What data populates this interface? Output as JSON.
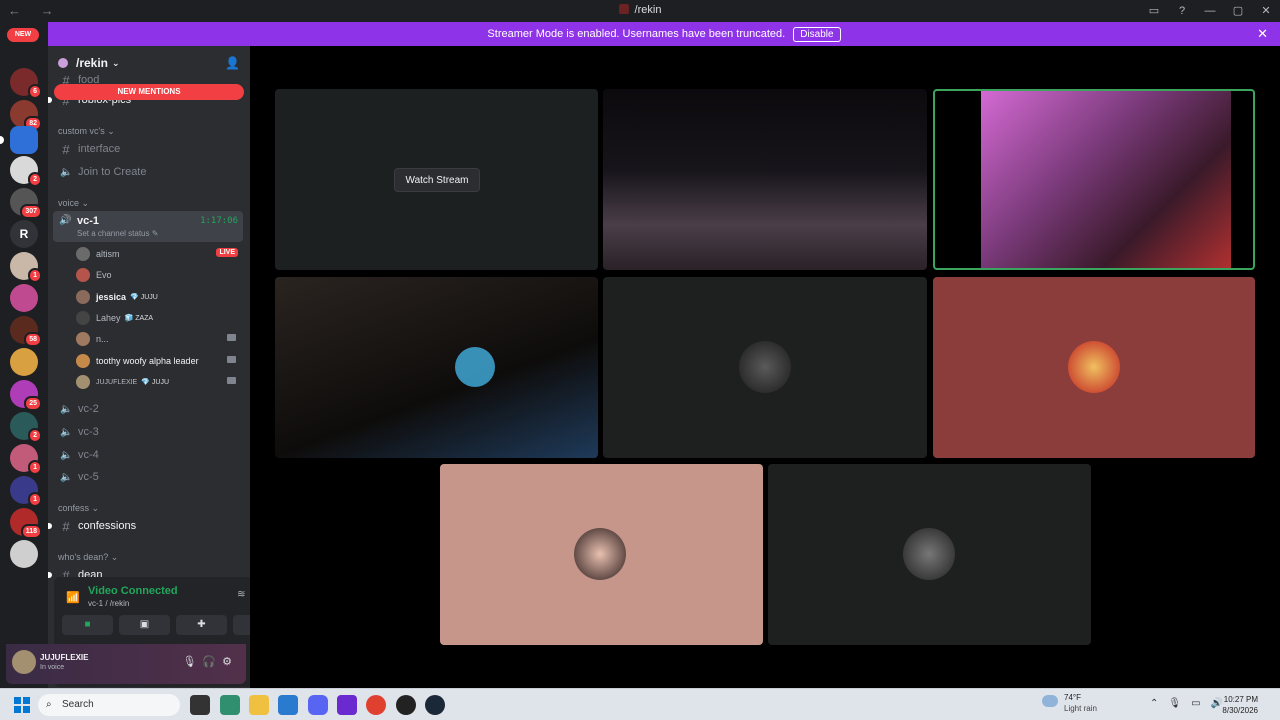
{
  "window": {
    "title": "/rekin",
    "nav": "← →",
    "controls": [
      "▭",
      "?",
      "—",
      "▢",
      "✕"
    ]
  },
  "banner": {
    "text": "Streamer Mode is enabled. Usernames have been truncated.",
    "button": "Disable",
    "close": "✕"
  },
  "rail": {
    "new_label": "NEW",
    "badges": [
      "6",
      "82",
      "2",
      "307",
      "1",
      "58",
      "25",
      "2",
      "1",
      "1",
      "118"
    ],
    "letter_server": "R"
  },
  "guild": {
    "name": "/rekin",
    "chevron": "⌄",
    "new_mentions": "NEW MENTIONS"
  },
  "channels": {
    "partial_top": "food",
    "roblox": "roblox-pics",
    "cat_custom": "custom vc's ⌄",
    "interface": "interface",
    "join_create": "Join to Create",
    "cat_voice": "voice ⌄",
    "vc1": "vc-1",
    "vc1_time": "1:17:06",
    "vc1_status": "Set a channel status ✎",
    "vc2": "vc-2",
    "vc3": "vc-3",
    "vc4": "vc-4",
    "vc5": "vc-5",
    "cat_confess": "confess ⌄",
    "confessions": "confessions",
    "cat_dean": "who's dean? ⌄",
    "dean": "dean"
  },
  "voice_users": [
    {
      "name": "altism",
      "tag": "",
      "live": "LIVE"
    },
    {
      "name": "Evo",
      "tag": ""
    },
    {
      "name": "jessica",
      "tag": "💎 JUJU"
    },
    {
      "name": "Lahey",
      "tag": "🧊 ZAZA"
    },
    {
      "name": "n...",
      "tag": ""
    },
    {
      "name": "toothy woofy alpha leader",
      "tag": ""
    },
    {
      "name": "JUJUFLEXIE",
      "tag": "💎 JUJU"
    }
  ],
  "voice_panel": {
    "title": "Video Connected",
    "subtitle": "vc-1 / /rekin"
  },
  "me": {
    "name": "JUJUFLEXIE",
    "status": "In voice"
  },
  "stage": {
    "watch_stream": "Watch Stream"
  },
  "taskbar": {
    "search_placeholder": "Search",
    "temp": "74°F",
    "weather": "Light rain",
    "time": "10:27 PM",
    "date": "8/30/2026"
  },
  "colors": {
    "accent_purple": "#8f33e8",
    "green": "#23a55a",
    "red": "#f23f43",
    "tile_red": "#8a3d3a",
    "tile_pink": "#c7968a"
  }
}
